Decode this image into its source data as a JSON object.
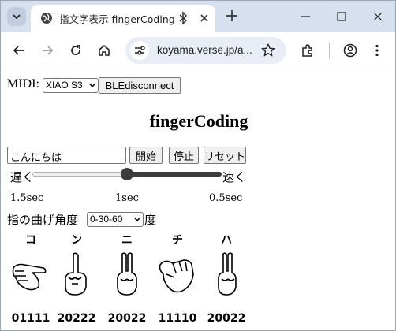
{
  "browser": {
    "tab_title": "指文字表示 fingerCoding",
    "url": "koyama.verse.jp/a..."
  },
  "page": {
    "midi_label": "MIDI:",
    "midi_selected": "XIAO S3",
    "ble_button": "BLEdisconnect",
    "title": "fingerCoding",
    "text_input_value": "こんにちは",
    "start_button": "開始",
    "stop_button": "停止",
    "reset_button": "リセット",
    "slow_label": "遅く",
    "fast_label": "速く",
    "speed_slider_fraction": 0.5,
    "speed_ticks": [
      "1.5sec",
      "1sec",
      "0.5sec"
    ],
    "angle_label": "指の曲げ角度",
    "angle_selected": "0-30-60",
    "angle_suffix": "度",
    "hands": [
      {
        "kana": "コ",
        "code": "01111"
      },
      {
        "kana": "ン",
        "code": "20222"
      },
      {
        "kana": "ニ",
        "code": "20022"
      },
      {
        "kana": "チ",
        "code": "11110"
      },
      {
        "kana": "ハ",
        "code": "20022"
      }
    ]
  },
  "icons": [
    "tab-search-icon",
    "globe-icon",
    "bluetooth-icon",
    "close-icon",
    "plus-icon",
    "minimize-icon",
    "maximize-icon",
    "close-window-icon",
    "back-icon",
    "forward-icon",
    "reload-icon",
    "home-icon",
    "site-info-icon",
    "star-icon",
    "extensions-icon",
    "account-icon",
    "menu-icon"
  ]
}
